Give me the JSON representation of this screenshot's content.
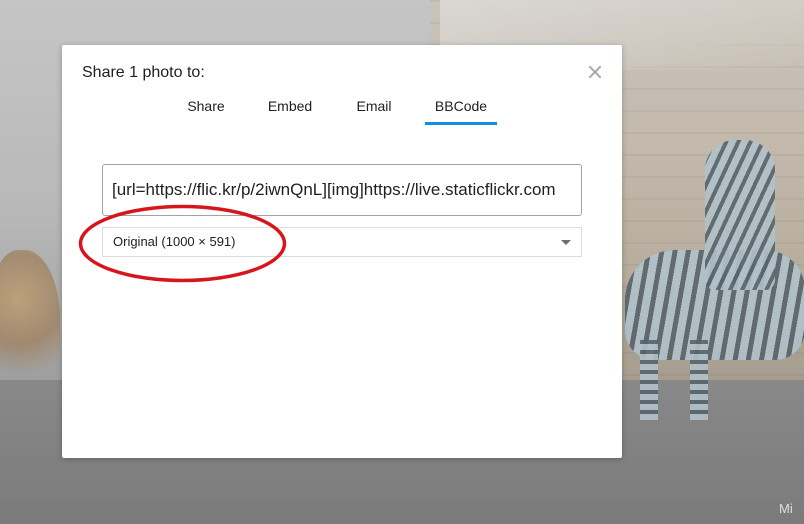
{
  "background": {
    "watermark_text": "Mi"
  },
  "dialog": {
    "title": "Share 1 photo to:",
    "close_icon": "close-icon",
    "tabs": [
      {
        "label": "Share",
        "active": false
      },
      {
        "label": "Embed",
        "active": false
      },
      {
        "label": "Email",
        "active": false
      },
      {
        "label": "BBCode",
        "active": true
      }
    ],
    "code_value": "[url=https://flic.kr/p/2iwnQnL][img]https://live.staticflickr.com",
    "size_select": {
      "selected": "Original (1000 × 591)",
      "icon": "chevron-down-icon"
    }
  },
  "colors": {
    "accent": "#128fdc",
    "annotation": "#d7161b"
  }
}
